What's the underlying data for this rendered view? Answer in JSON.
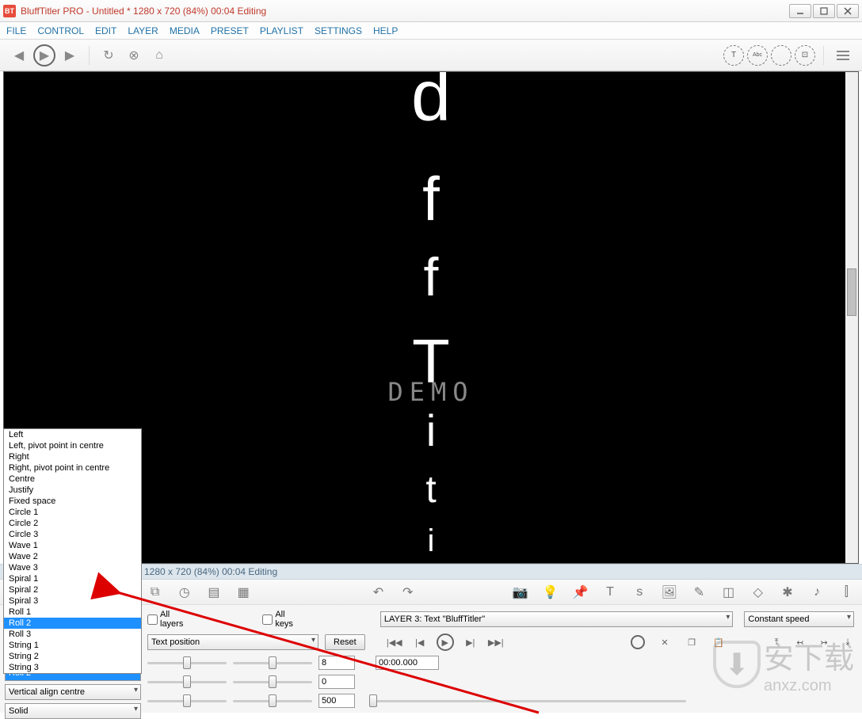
{
  "titlebar": {
    "app": "BluffTitler PRO",
    "doc": "  -  Untitled * 1280 x 720 (84%) 00:04 Editing"
  },
  "menubar": [
    "FILE",
    "CONTROL",
    "EDIT",
    "LAYER",
    "MEDIA",
    "PRESET",
    "PLAYLIST",
    "SETTINGS",
    "HELP"
  ],
  "viewport": {
    "demo": "DEMO"
  },
  "status": "1280 x 720 (84%) 00:04 Editing",
  "dropdown_options": [
    "Left",
    "Left, pivot point in centre",
    "Right",
    "Right, pivot point in centre",
    "Centre",
    "Justify",
    "Fixed space",
    "Circle 1",
    "Circle 2",
    "Circle 3",
    "Wave 1",
    "Wave 2",
    "Wave 3",
    "Spiral 1",
    "Spiral 2",
    "Spiral 3",
    "Roll 1",
    "Roll 2",
    "Roll 3",
    "String 1",
    "String 2",
    "String 3"
  ],
  "dropdown_selected_index": 17,
  "controls": {
    "all_layers": "All layers",
    "all_keys": "All keys",
    "layer_select": "LAYER 3: Text \"BluffTitler\"",
    "speed_select": "Constant speed",
    "property_select": "Text position",
    "reset": "Reset",
    "time": "00:00.000",
    "v1": "8",
    "v2": "0",
    "v3": "500"
  },
  "lower_selects": {
    "s1": "Roll 2",
    "s2": "Vertical align centre",
    "s3": "Solid"
  },
  "watermark": {
    "cn": "安下载",
    "en": "anxz.com"
  }
}
